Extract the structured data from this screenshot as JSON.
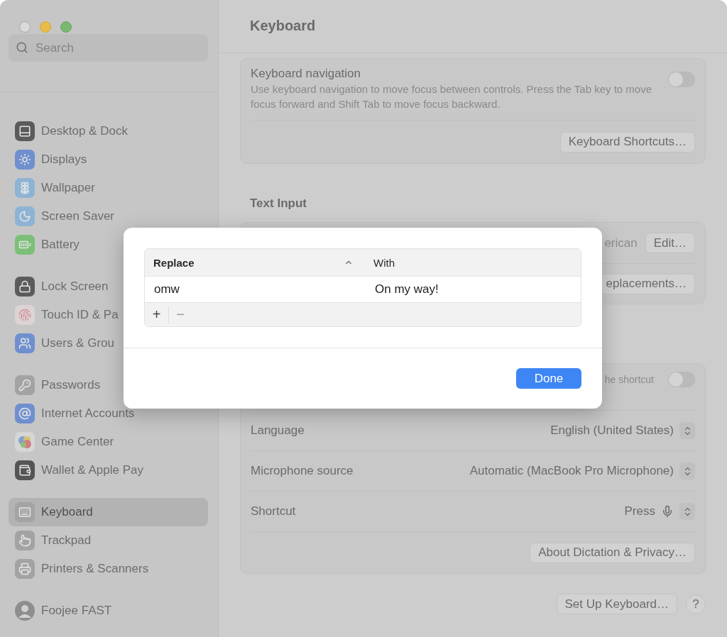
{
  "sidebar": {
    "search": {
      "placeholder": "Search"
    },
    "groups": [
      {
        "items": [
          {
            "label": "Desktop & Dock",
            "selected": false
          },
          {
            "label": "Displays",
            "selected": false
          },
          {
            "label": "Wallpaper",
            "selected": false
          },
          {
            "label": "Screen Saver",
            "selected": false
          },
          {
            "label": "Battery",
            "selected": false
          }
        ]
      },
      {
        "items": [
          {
            "label": "Lock Screen",
            "selected": false
          },
          {
            "label": "Touch ID & Pa",
            "selected": false
          },
          {
            "label": "Users & Grou",
            "selected": false
          }
        ]
      },
      {
        "items": [
          {
            "label": "Passwords",
            "selected": false
          },
          {
            "label": "Internet Accounts",
            "selected": false
          },
          {
            "label": "Game Center",
            "selected": false
          },
          {
            "label": "Wallet & Apple Pay",
            "selected": false
          }
        ]
      },
      {
        "items": [
          {
            "label": "Keyboard",
            "selected": true
          },
          {
            "label": "Trackpad",
            "selected": false
          },
          {
            "label": "Printers & Scanners",
            "selected": false
          }
        ]
      },
      {
        "items": [
          {
            "label": "Foojee FAST",
            "selected": false
          }
        ]
      }
    ]
  },
  "main": {
    "title": "Keyboard",
    "keyboard_navigation": {
      "title": "Keyboard navigation",
      "description": "Use keyboard navigation to move focus between controls. Press the Tab key to move focus forward and Shift Tab to move focus backward.",
      "on": false,
      "button": "Keyboard Shortcuts…"
    },
    "text_input": {
      "heading": "Text Input",
      "rows": [
        {
          "value": "erican",
          "button": "Edit…"
        },
        {
          "button": "eplacements…"
        }
      ]
    },
    "dictation": {
      "toggle_row": {
        "label": "he shortcut",
        "on": false
      },
      "rows": [
        {
          "kind": "select",
          "label": "Language",
          "value": "English (United States)"
        },
        {
          "kind": "select",
          "label": "Microphone source",
          "value": "Automatic (MacBook Pro Microphone)"
        },
        {
          "kind": "shortcut",
          "label": "Shortcut",
          "value": "Press"
        }
      ],
      "button": "About Dictation & Privacy…"
    },
    "footer": {
      "setup_button": "Set Up Keyboard…",
      "help_button": "?"
    }
  },
  "dialog": {
    "columns": [
      {
        "label": "Replace",
        "sorted": true
      },
      {
        "label": "With",
        "sorted": false
      }
    ],
    "rows": [
      {
        "replace": "omw",
        "with": "On my way!"
      }
    ],
    "add_button": {
      "label": "+",
      "disabled": false
    },
    "remove_button": {
      "label": "−",
      "disabled": true
    },
    "done_button": "Done"
  }
}
